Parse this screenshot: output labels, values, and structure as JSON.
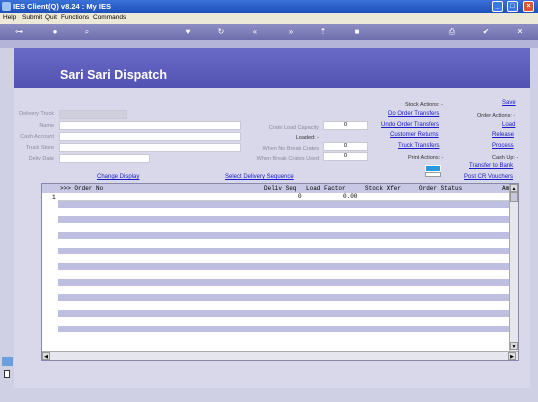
{
  "window": {
    "title": "IES Client(Q) v8.24 : My IES"
  },
  "menu": [
    "Help",
    "Submit",
    "Quit",
    "Functions",
    "Commands"
  ],
  "header": {
    "title": "Sari Sari Dispatch"
  },
  "form": {
    "delivery_truck_label": "Delivery Truck",
    "name_label": "Name",
    "cash_account_label": "Cash Account",
    "truck_store_label": "Truck Store",
    "deliv_date_label": "Deliv Date",
    "crate_load_capacity_label": "Crate Load Capacity",
    "crate_load_capacity_value": "0",
    "loaded_label": "Loaded: -",
    "when_no_break_crates_label": "When No Break Crates",
    "when_no_break_crates_value": "0",
    "when_break_crates_used_label": "When Break Crates Used",
    "when_break_crates_used_value": "0"
  },
  "actions": {
    "stock_actions_label": "Stock Actions: -",
    "do_order_transfers": "Do Order Transfers",
    "undo_order_transfers": "Undo Order Transfers",
    "customer_returns": "Customer Returns",
    "truck_transfers": "Truck Transfers",
    "print_actions_label": "Print Actions: -",
    "save": "Save",
    "order_actions_label": "Order Actions: -",
    "load": "Load",
    "release": "Release",
    "process": "Process",
    "cash_up_label": "Cash Up: -",
    "transfer_to_bank": "Transfer to Bank",
    "post_cr_vouchers": "Post CR Vouchers",
    "change_display": "Change Display",
    "select_delivery_sequence": "Select Delivery Sequence"
  },
  "grid": {
    "headers": [
      ">>> Order No",
      "Deliv Seq",
      "Load Factor",
      "Stock Xfer",
      "Order Status",
      "Am"
    ],
    "first_row": {
      "row_num": "1",
      "deliv_seq": "0",
      "load_factor": "0.00"
    }
  },
  "colors": {
    "header_band": "#5a5abc",
    "link": "#1a1ac8",
    "alt_row": "#bebee0"
  }
}
